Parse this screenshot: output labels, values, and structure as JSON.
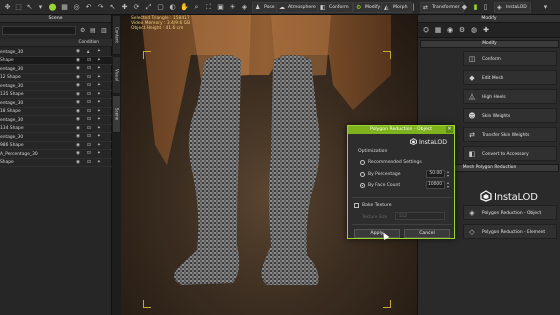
{
  "toolbar": {
    "buttons": [
      "Pose",
      "Atmosphere",
      "Conform",
      "Modify",
      "Morph",
      "Transformer",
      "InstaLOD"
    ]
  },
  "scene": {
    "title": "Scene",
    "header": "Condition",
    "rows": [
      "entage_30",
      "Shape",
      "entage_30",
      "12 Shape",
      "entage_30",
      "135 Shape",
      "entage_30",
      "18 Shape",
      "entage_30",
      "134 Shape",
      "entage_30",
      "986 Shape",
      "A_Percentage_30",
      "Shape"
    ],
    "side_tabs": [
      "Content",
      "Visual",
      "Scene"
    ]
  },
  "viewport": {
    "info_lines": [
      "Selected Triangle : 158417",
      "Video Memory : 3.4/9.6 GB",
      "Object Height : 41.6 cm"
    ]
  },
  "modify": {
    "title": "Modify",
    "section1": "Modify",
    "buttons": [
      "Conform",
      "Edit Mesh",
      "High Heels",
      "Skin Weights",
      "Transfer Skin Weights",
      "Convert to Accessory"
    ],
    "section2": "Mesh Polygon Reduction",
    "logo_text": "InstaLOD",
    "reduction_buttons": [
      "Polygon Reduction - Object",
      "Polygon Reduction - Element"
    ]
  },
  "dialog": {
    "title": "Polygon Reduction - Object",
    "close_glyph": "✕",
    "logo_text": "InstaLOD",
    "section": "Optimization",
    "options": [
      {
        "label": "Recommended Settings",
        "selected": false
      },
      {
        "label": "By Percentage",
        "value": "50.00",
        "selected": false
      },
      {
        "label": "By Face Count",
        "value": "10000",
        "selected": true
      }
    ],
    "bake_texture_label": "Bake Texture",
    "texture_size_label": "Texture Size",
    "texture_size_value": "512",
    "apply_label": "Apply",
    "cancel_label": "Cancel"
  },
  "colors": {
    "accent": "#9ad42c",
    "dialog_title": "#7fb31e",
    "viewport_hint": "#c9a83a"
  }
}
